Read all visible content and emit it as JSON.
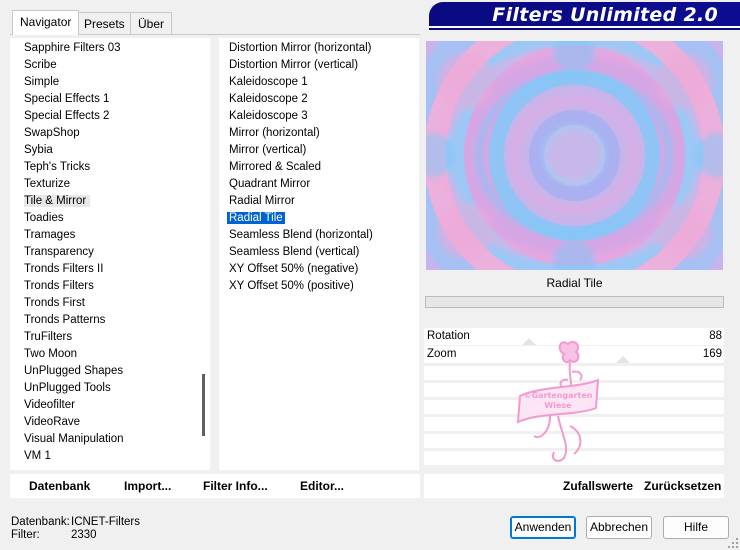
{
  "tabs": [
    {
      "label": "Navigator",
      "active": true
    },
    {
      "label": "Presets",
      "active": false
    },
    {
      "label": "Über",
      "active": false
    }
  ],
  "banner": {
    "title": "Filters Unlimited 2.0"
  },
  "categories": {
    "items": [
      "Sapphire Filters 03",
      "Scribe",
      "Simple",
      "Special Effects 1",
      "Special Effects 2",
      "SwapShop",
      "Sybia",
      "Teph's Tricks",
      "Texturize",
      "Tile & Mirror",
      "Toadies",
      "Tramages",
      "Transparency",
      "Tronds Filters II",
      "Tronds Filters",
      "Tronds First",
      "Tronds Patterns",
      "TruFilters",
      "Two Moon",
      "UnPlugged Shapes",
      "UnPlugged Tools",
      "Videofilter",
      "VideoRave",
      "Visual Manipulation",
      "VM 1"
    ],
    "selected": "Tile & Mirror"
  },
  "filters": {
    "items": [
      "Distortion Mirror (horizontal)",
      "Distortion Mirror (vertical)",
      "Kaleidoscope 1",
      "Kaleidoscope 2",
      "Kaleidoscope 3",
      "Mirror (horizontal)",
      "Mirror (vertical)",
      "Mirrored & Scaled",
      "Quadrant Mirror",
      "Radial Mirror",
      "Radial Tile",
      "Seamless Blend (horizontal)",
      "Seamless Blend (vertical)",
      "XY Offset 50% (negative)",
      "XY Offset 50% (positive)"
    ],
    "selected": "Radial Tile"
  },
  "preview": {
    "filter_name": "Radial Tile"
  },
  "params": [
    {
      "label": "Rotation",
      "value": "88"
    },
    {
      "label": "Zoom",
      "value": "169"
    }
  ],
  "watermark": {
    "text_line1": "©Gartengarten",
    "text_line2": "Wiese"
  },
  "toolbar_left": {
    "database": "Datenbank",
    "import": "Import...",
    "filter_info": "Filter Info...",
    "editor": "Editor..."
  },
  "toolbar_right": {
    "random": "Zufallswerte",
    "reset": "Zurücksetzen"
  },
  "status": {
    "database_label": "Datenbank:",
    "database_value": "ICNET-Filters",
    "filter_label": "Filter:",
    "filter_value": "2330"
  },
  "buttons": {
    "apply": "Anwenden",
    "cancel": "Abbrechen",
    "help": "Hilfe"
  },
  "colors": {
    "banner": "#0a0a80",
    "selection": "#0063d1",
    "watermark": "#f29ad0"
  }
}
